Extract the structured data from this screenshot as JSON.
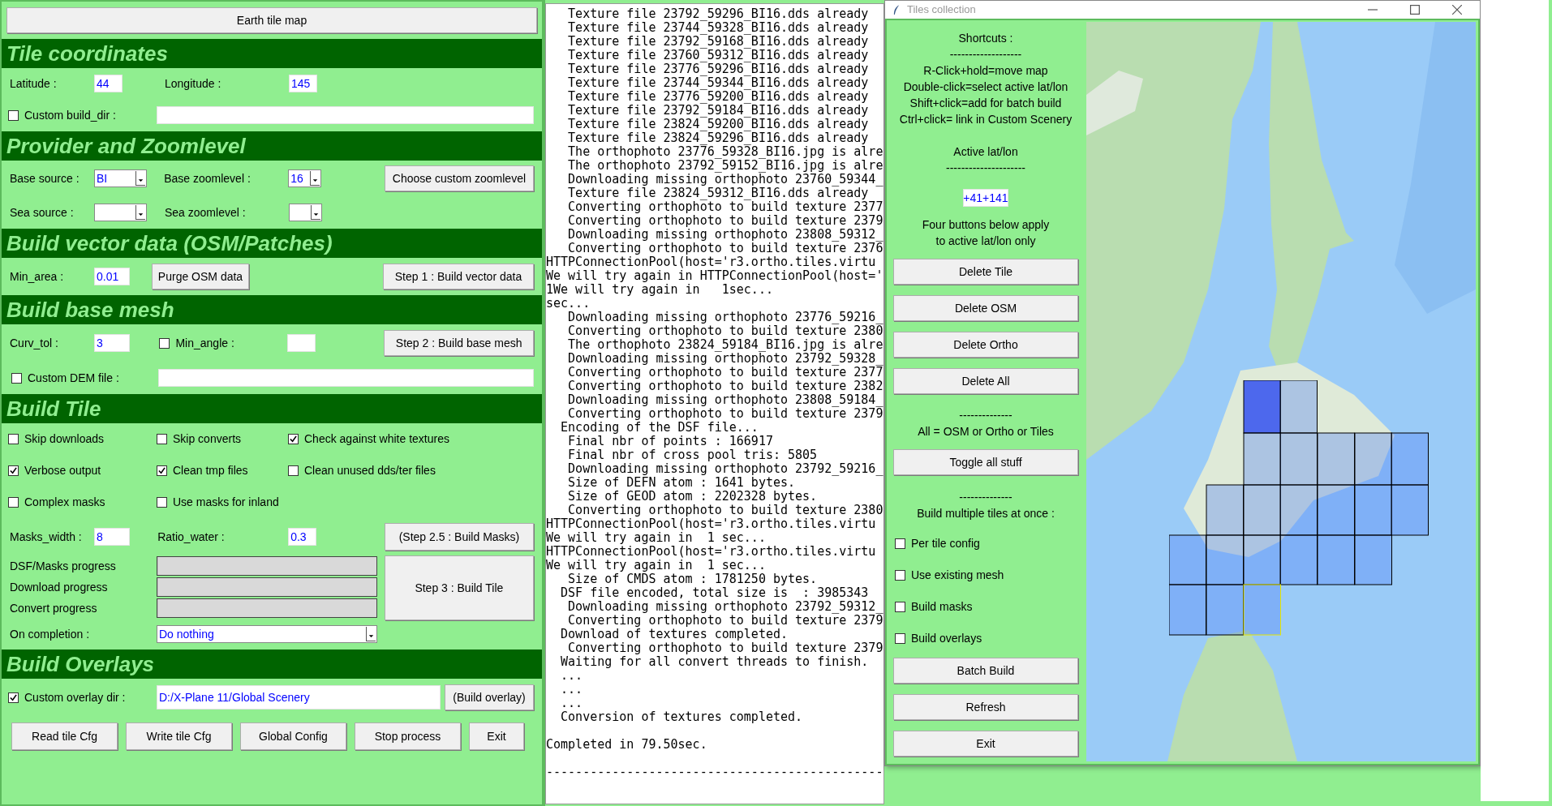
{
  "tiles_window": {
    "title": "Tiles collection"
  },
  "main": {
    "earth_tile_map_button": "Earth tile map",
    "tile_coordinates": {
      "heading": "Tile coordinates",
      "latitude": {
        "label": "Latitude  :",
        "value": "44"
      },
      "longitude": {
        "label": "Longitude  :",
        "value": "145"
      },
      "custom_build_dir": {
        "label": "Custom build_dir  :",
        "checked": false
      }
    },
    "provider": {
      "heading": "Provider and Zoomlevel",
      "base_source": {
        "label": "Base source  :",
        "value": "BI"
      },
      "base_zoomlevel": {
        "label": "Base zoomlevel  :",
        "value": "16"
      },
      "custom_zoom_button": "Choose custom zoomlevel",
      "sea_source": {
        "label": "Sea source  :"
      },
      "sea_zoomlevel": {
        "label": "Sea zoomlevel  :"
      }
    },
    "vector": {
      "heading": "Build vector data (OSM/Patches)",
      "min_area": {
        "label": "Min_area  :",
        "value": "0.01"
      },
      "purge_button": "Purge OSM data",
      "step_button": "Step 1 : Build vector data"
    },
    "mesh": {
      "heading": "Build base mesh",
      "curv_tol": {
        "label": "Curv_tol  :",
        "value": "3"
      },
      "min_angle": {
        "label": "Min_angle :",
        "checked": false
      },
      "step_button": "Step 2 : Build base mesh",
      "custom_dem": {
        "label": "Custom DEM file :",
        "checked": false
      }
    },
    "tile": {
      "heading": "Build Tile",
      "options": [
        {
          "label": "Skip downloads",
          "checked": false
        },
        {
          "label": "Skip converts",
          "checked": false
        },
        {
          "label": "Check against white textures",
          "checked": true
        },
        {
          "label": "Verbose output",
          "checked": true
        },
        {
          "label": "Clean tmp files",
          "checked": true
        },
        {
          "label": "Clean unused dds/ter files",
          "checked": false
        },
        {
          "label": "Complex masks",
          "checked": false
        },
        {
          "label": "Use masks for inland",
          "checked": false
        }
      ],
      "masks_width": {
        "label": "Masks_width :",
        "value": "8"
      },
      "ratio_water": {
        "label": "Ratio_water :",
        "value": "0.3"
      },
      "masks_button": "(Step 2.5 : Build Masks)",
      "progress": [
        {
          "label": "DSF/Masks progress",
          "level": 0
        },
        {
          "label": "Download progress",
          "level": 0
        },
        {
          "label": "Convert progress",
          "level": 0
        }
      ],
      "build_button": "Step 3 : Build Tile",
      "on_completion": {
        "label": "On completion :",
        "value": "Do nothing"
      }
    },
    "overlays": {
      "heading": "Build Overlays",
      "custom_overlay_dir": {
        "label": "Custom overlay dir :",
        "checked": true,
        "value": "D:/X-Plane 11/Global Scenery"
      },
      "build_button": "(Build overlay)"
    },
    "buttons": [
      "Read tile Cfg",
      "Write tile Cfg",
      "Global Config",
      "Stop process",
      "Exit"
    ]
  },
  "log": {
    "lines": [
      "   Texture file 23792_59296_BI16.dds already",
      "   Texture file 23744_59328_BI16.dds already",
      "   Texture file 23792_59168_BI16.dds already",
      "   Texture file 23760_59312_BI16.dds already",
      "   Texture file 23776_59296_BI16.dds already",
      "   Texture file 23744_59344_BI16.dds already",
      "   Texture file 23776_59200_BI16.dds already",
      "   Texture file 23792_59184_BI16.dds already",
      "   Texture file 23824_59200_BI16.dds already",
      "   Texture file 23824_59296_BI16.dds already",
      "   The orthophoto 23776_59328_BI16.jpg is alre",
      "   The orthophoto 23792_59152_BI16.jpg is alre",
      "   Downloading missing orthophoto 23760_59344_",
      "   Texture file 23824_59312_BI16.dds already",
      "   Converting orthophoto to build texture 2377",
      "   Converting orthophoto to build texture 2379",
      "   Downloading missing orthophoto 23808_59312_",
      "   Converting orthophoto to build texture 2376",
      "HTTPConnectionPool(host='r3.ortho.tiles.virtu",
      "We will try again in HTTPConnectionPool(host='",
      "1We will try again in   1sec...",
      "sec...",
      "   Downloading missing orthophoto 23776_59216_",
      "   Converting orthophoto to build texture 2380",
      "   The orthophoto 23824_59184_BI16.jpg is alre",
      "   Downloading missing orthophoto 23792_59328_",
      "   Converting orthophoto to build texture 2377",
      "   Converting orthophoto to build texture 2382",
      "   Downloading missing orthophoto 23808_59184_",
      "   Converting orthophoto to build texture 2379",
      "  Encoding of the DSF file...",
      "   Final nbr of points : 166917",
      "   Final nbr of cross pool tris: 5805",
      "   Downloading missing orthophoto 23792_59216_",
      "   Size of DEFN atom : 1641 bytes.",
      "   Size of GEOD atom : 2202328 bytes.",
      "   Converting orthophoto to build texture 2380",
      "HTTPConnectionPool(host='r3.ortho.tiles.virtu",
      "We will try again in  1 sec...",
      "HTTPConnectionPool(host='r3.ortho.tiles.virtu",
      "We will try again in  1 sec...",
      "   Size of CMDS atom : 1781250 bytes.",
      "  DSF file encoded, total size is  : 3985343",
      "   Downloading missing orthophoto 23792_59312_",
      "   Converting orthophoto to build texture 2379",
      "  Download of textures completed.",
      "   Converting orthophoto to build texture 2379",
      "  Waiting for all convert threads to finish.",
      "  ...",
      "  ...",
      "  ...",
      "  Conversion of textures completed."
    ],
    "summary": "Completed in 79.50sec.",
    "rule": "----------------------------------------------"
  },
  "tiles_collection": {
    "shortcuts_heading": "Shortcuts :",
    "divider_1": "-------------------",
    "shortcuts": [
      "R-Click+hold=move map",
      "Double-click=select active lat/lon",
      "Shift+click=add for batch build",
      "Ctrl+click= link in Custom Scenery"
    ],
    "active_heading": "Active lat/lon",
    "divider_2": "---------------------",
    "active_value": "+41+141",
    "note": [
      "Four buttons below apply",
      "to active lat/lon only"
    ],
    "delete_buttons": [
      "Delete Tile",
      "Delete OSM",
      "Delete Ortho",
      "Delete All"
    ],
    "divider_3": "--------------",
    "all_note": "All = OSM or Ortho or Tiles",
    "toggle_button": "Toggle all stuff",
    "divider_4": "--------------",
    "batch_heading": "Build multiple tiles at once :",
    "batch_options": [
      {
        "label": "Per tile config",
        "checked": false
      },
      {
        "label": "Use existing mesh",
        "checked": false
      },
      {
        "label": "Build masks",
        "checked": false
      },
      {
        "label": "Build overlays",
        "checked": false
      }
    ],
    "batch_button": "Batch Build",
    "refresh_button": "Refresh",
    "exit_button": "Exit"
  }
}
